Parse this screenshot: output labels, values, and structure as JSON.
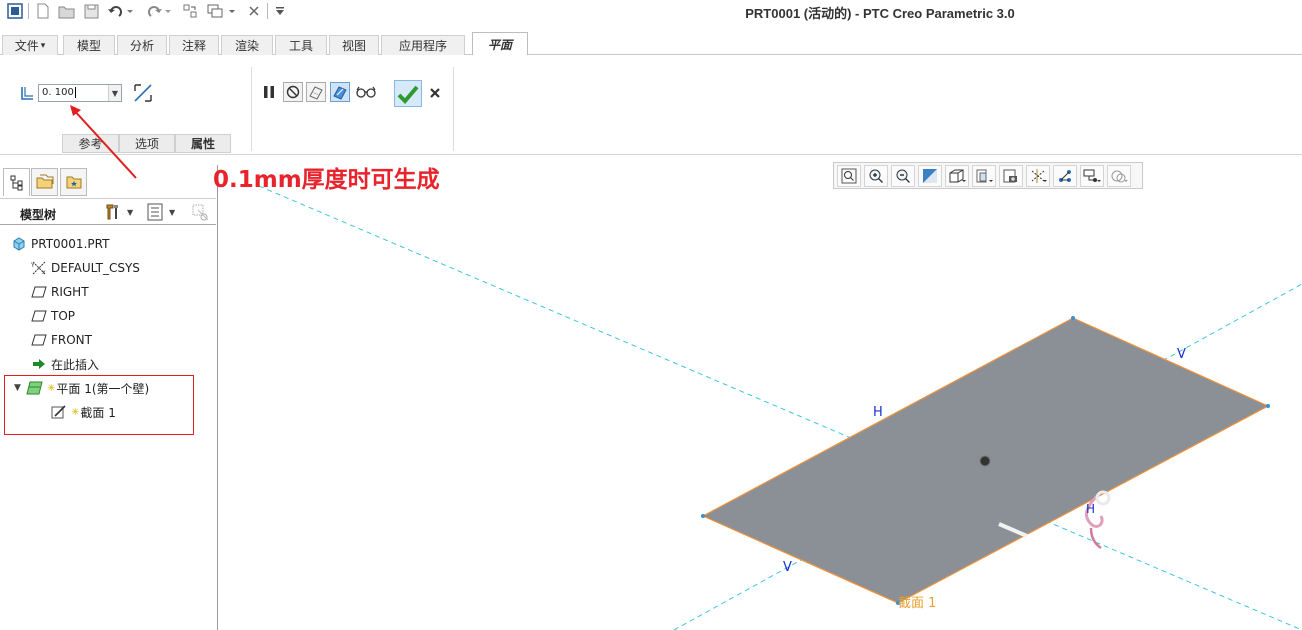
{
  "window": {
    "title": "PRT0001 (活动的) - PTC Creo Parametric 3.0"
  },
  "quick_access": {
    "icons": [
      "app-icon",
      "new-icon",
      "open-icon",
      "save-icon",
      "undo-icon",
      "redo-icon",
      "regenerate-icon",
      "windows-icon",
      "close-window-icon",
      "customize-icon"
    ]
  },
  "tabs": [
    {
      "label": "文件",
      "suffix": "▾"
    },
    {
      "label": "模型"
    },
    {
      "label": "分析"
    },
    {
      "label": "注释"
    },
    {
      "label": "渲染"
    },
    {
      "label": "工具"
    },
    {
      "label": "视图"
    },
    {
      "label": "应用程序"
    },
    {
      "label": "平面"
    }
  ],
  "ribbon": {
    "thickness_value": "0. 100",
    "subtabs": {
      "references": "参考",
      "options": "选项",
      "properties": "属性"
    }
  },
  "annotation": {
    "text": "0.1mm厚度时可生成",
    "color": "#e8232b"
  },
  "model_tree": {
    "title": "模型树",
    "items": [
      {
        "label": "PRT0001.PRT",
        "icon": "part-icon"
      },
      {
        "label": "DEFAULT_CSYS",
        "icon": "csys-icon"
      },
      {
        "label": "RIGHT",
        "icon": "datum-plane-icon"
      },
      {
        "label": "TOP",
        "icon": "datum-plane-icon"
      },
      {
        "label": "FRONT",
        "icon": "datum-plane-icon"
      },
      {
        "label": "在此插入",
        "icon": "insert-here-icon"
      },
      {
        "label": "平面 1(第一个壁)",
        "icon": "flat-wall-icon"
      },
      {
        "label": "截面 1",
        "icon": "sketch-icon"
      }
    ]
  },
  "graphics": {
    "labels": {
      "h_top": "H",
      "v_right": "V",
      "v_bottom": "V",
      "h_dragger": "H",
      "section": "截面 1"
    },
    "colors": {
      "surface": "#8a9096",
      "edge": "#f0923a",
      "datum_line": "#3cc6dd",
      "axis_label": "#1a2fd0",
      "section_label": "#e8a030"
    }
  }
}
